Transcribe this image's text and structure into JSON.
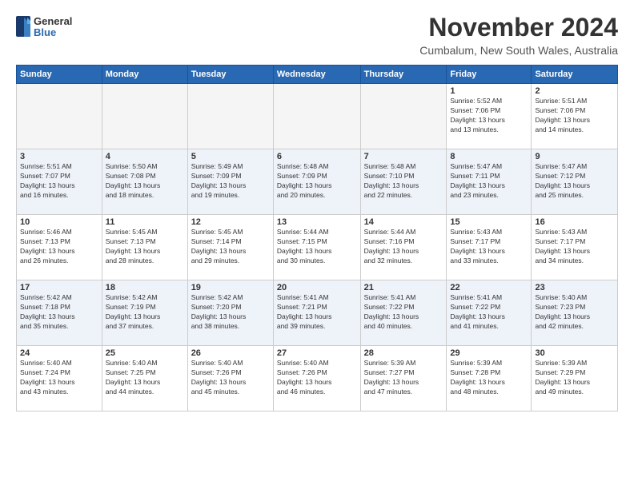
{
  "header": {
    "logo_line1": "General",
    "logo_line2": "Blue",
    "month_title": "November 2024",
    "location": "Cumbalum, New South Wales, Australia"
  },
  "days_of_week": [
    "Sunday",
    "Monday",
    "Tuesday",
    "Wednesday",
    "Thursday",
    "Friday",
    "Saturday"
  ],
  "weeks": [
    [
      {
        "day": "",
        "info": ""
      },
      {
        "day": "",
        "info": ""
      },
      {
        "day": "",
        "info": ""
      },
      {
        "day": "",
        "info": ""
      },
      {
        "day": "",
        "info": ""
      },
      {
        "day": "1",
        "info": "Sunrise: 5:52 AM\nSunset: 7:06 PM\nDaylight: 13 hours\nand 13 minutes."
      },
      {
        "day": "2",
        "info": "Sunrise: 5:51 AM\nSunset: 7:06 PM\nDaylight: 13 hours\nand 14 minutes."
      }
    ],
    [
      {
        "day": "3",
        "info": "Sunrise: 5:51 AM\nSunset: 7:07 PM\nDaylight: 13 hours\nand 16 minutes."
      },
      {
        "day": "4",
        "info": "Sunrise: 5:50 AM\nSunset: 7:08 PM\nDaylight: 13 hours\nand 18 minutes."
      },
      {
        "day": "5",
        "info": "Sunrise: 5:49 AM\nSunset: 7:09 PM\nDaylight: 13 hours\nand 19 minutes."
      },
      {
        "day": "6",
        "info": "Sunrise: 5:48 AM\nSunset: 7:09 PM\nDaylight: 13 hours\nand 20 minutes."
      },
      {
        "day": "7",
        "info": "Sunrise: 5:48 AM\nSunset: 7:10 PM\nDaylight: 13 hours\nand 22 minutes."
      },
      {
        "day": "8",
        "info": "Sunrise: 5:47 AM\nSunset: 7:11 PM\nDaylight: 13 hours\nand 23 minutes."
      },
      {
        "day": "9",
        "info": "Sunrise: 5:47 AM\nSunset: 7:12 PM\nDaylight: 13 hours\nand 25 minutes."
      }
    ],
    [
      {
        "day": "10",
        "info": "Sunrise: 5:46 AM\nSunset: 7:13 PM\nDaylight: 13 hours\nand 26 minutes."
      },
      {
        "day": "11",
        "info": "Sunrise: 5:45 AM\nSunset: 7:13 PM\nDaylight: 13 hours\nand 28 minutes."
      },
      {
        "day": "12",
        "info": "Sunrise: 5:45 AM\nSunset: 7:14 PM\nDaylight: 13 hours\nand 29 minutes."
      },
      {
        "day": "13",
        "info": "Sunrise: 5:44 AM\nSunset: 7:15 PM\nDaylight: 13 hours\nand 30 minutes."
      },
      {
        "day": "14",
        "info": "Sunrise: 5:44 AM\nSunset: 7:16 PM\nDaylight: 13 hours\nand 32 minutes."
      },
      {
        "day": "15",
        "info": "Sunrise: 5:43 AM\nSunset: 7:17 PM\nDaylight: 13 hours\nand 33 minutes."
      },
      {
        "day": "16",
        "info": "Sunrise: 5:43 AM\nSunset: 7:17 PM\nDaylight: 13 hours\nand 34 minutes."
      }
    ],
    [
      {
        "day": "17",
        "info": "Sunrise: 5:42 AM\nSunset: 7:18 PM\nDaylight: 13 hours\nand 35 minutes."
      },
      {
        "day": "18",
        "info": "Sunrise: 5:42 AM\nSunset: 7:19 PM\nDaylight: 13 hours\nand 37 minutes."
      },
      {
        "day": "19",
        "info": "Sunrise: 5:42 AM\nSunset: 7:20 PM\nDaylight: 13 hours\nand 38 minutes."
      },
      {
        "day": "20",
        "info": "Sunrise: 5:41 AM\nSunset: 7:21 PM\nDaylight: 13 hours\nand 39 minutes."
      },
      {
        "day": "21",
        "info": "Sunrise: 5:41 AM\nSunset: 7:22 PM\nDaylight: 13 hours\nand 40 minutes."
      },
      {
        "day": "22",
        "info": "Sunrise: 5:41 AM\nSunset: 7:22 PM\nDaylight: 13 hours\nand 41 minutes."
      },
      {
        "day": "23",
        "info": "Sunrise: 5:40 AM\nSunset: 7:23 PM\nDaylight: 13 hours\nand 42 minutes."
      }
    ],
    [
      {
        "day": "24",
        "info": "Sunrise: 5:40 AM\nSunset: 7:24 PM\nDaylight: 13 hours\nand 43 minutes."
      },
      {
        "day": "25",
        "info": "Sunrise: 5:40 AM\nSunset: 7:25 PM\nDaylight: 13 hours\nand 44 minutes."
      },
      {
        "day": "26",
        "info": "Sunrise: 5:40 AM\nSunset: 7:26 PM\nDaylight: 13 hours\nand 45 minutes."
      },
      {
        "day": "27",
        "info": "Sunrise: 5:40 AM\nSunset: 7:26 PM\nDaylight: 13 hours\nand 46 minutes."
      },
      {
        "day": "28",
        "info": "Sunrise: 5:39 AM\nSunset: 7:27 PM\nDaylight: 13 hours\nand 47 minutes."
      },
      {
        "day": "29",
        "info": "Sunrise: 5:39 AM\nSunset: 7:28 PM\nDaylight: 13 hours\nand 48 minutes."
      },
      {
        "day": "30",
        "info": "Sunrise: 5:39 AM\nSunset: 7:29 PM\nDaylight: 13 hours\nand 49 minutes."
      }
    ]
  ]
}
